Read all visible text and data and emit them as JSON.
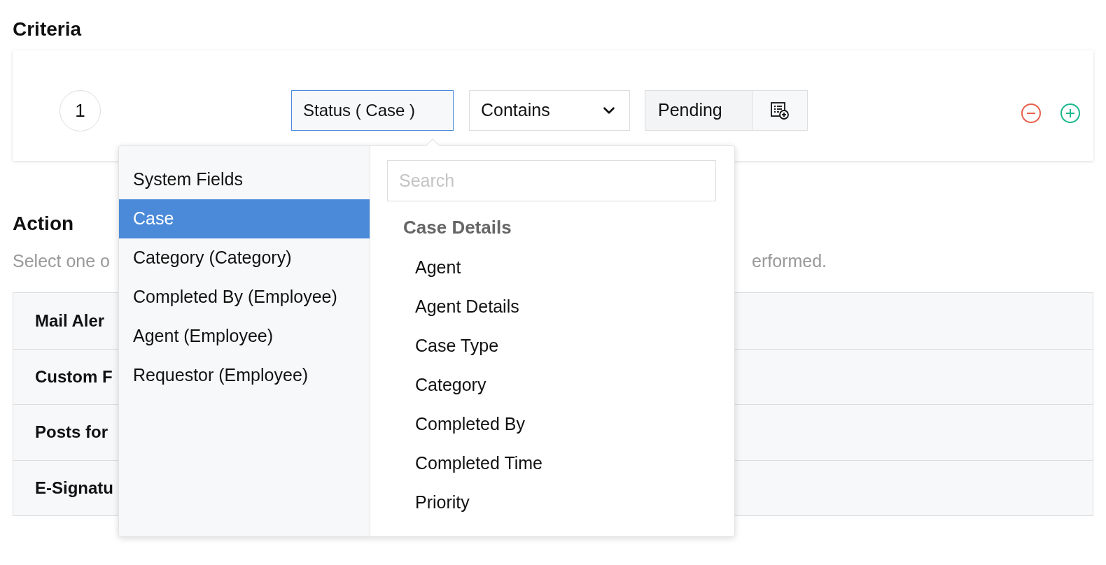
{
  "criteria": {
    "title": "Criteria",
    "rows": [
      {
        "index": "1",
        "field": "Status ( Case )",
        "field_open": true,
        "operator": "Contains",
        "value": "Pending"
      }
    ]
  },
  "action": {
    "title": "Action",
    "description_start": "Select one o",
    "description_end": "erformed.",
    "items": [
      "Mail Aler",
      "Custom F",
      "Posts for",
      "E-Signatu"
    ]
  },
  "field_picker": {
    "modules": [
      {
        "label": "System Fields",
        "selected": false
      },
      {
        "label": "Case",
        "selected": true
      },
      {
        "label": "Category (Category)",
        "selected": false
      },
      {
        "label": "Completed By (Employee)",
        "selected": false
      },
      {
        "label": "Agent (Employee)",
        "selected": false
      },
      {
        "label": "Requestor (Employee)",
        "selected": false
      }
    ],
    "search": {
      "placeholder": "Search"
    },
    "group": "Case Details",
    "fields": [
      "Agent",
      "Agent Details",
      "Case Type",
      "Category",
      "Completed By",
      "Completed Time",
      "Priority"
    ]
  }
}
